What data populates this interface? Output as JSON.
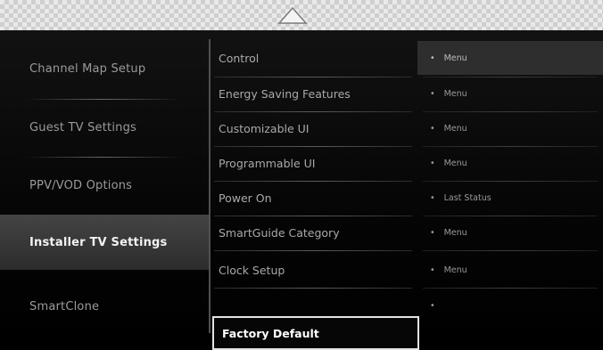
{
  "left_menu": {
    "items": [
      {
        "label": "Channel Map Setup"
      },
      {
        "label": "Guest TV Settings"
      },
      {
        "label": "PPV/VOD Options"
      },
      {
        "label": "Installer TV Settings"
      },
      {
        "label": "SmartClone"
      }
    ],
    "active_index": 3
  },
  "middle_menu": {
    "items": [
      {
        "label": "Control",
        "value": "Menu"
      },
      {
        "label": "Energy Saving Features",
        "value": "Menu"
      },
      {
        "label": "Customizable UI",
        "value": "Menu"
      },
      {
        "label": "Programmable UI",
        "value": "Menu"
      },
      {
        "label": "Power On",
        "value": "Last Status"
      },
      {
        "label": "SmartGuide Category",
        "value": "Menu"
      },
      {
        "label": "Clock Setup",
        "value": "Menu"
      },
      {
        "label": "Factory Default",
        "value": ""
      }
    ],
    "selected_index": 7
  },
  "icons": {
    "scroll_up": "up-arrow-icon",
    "bullet": "bullet-dot-icon"
  },
  "colors": {
    "selection_border": "#e3e3e3",
    "active_background": "#3a3a3a",
    "highlight_background": "#2e2e2e"
  }
}
